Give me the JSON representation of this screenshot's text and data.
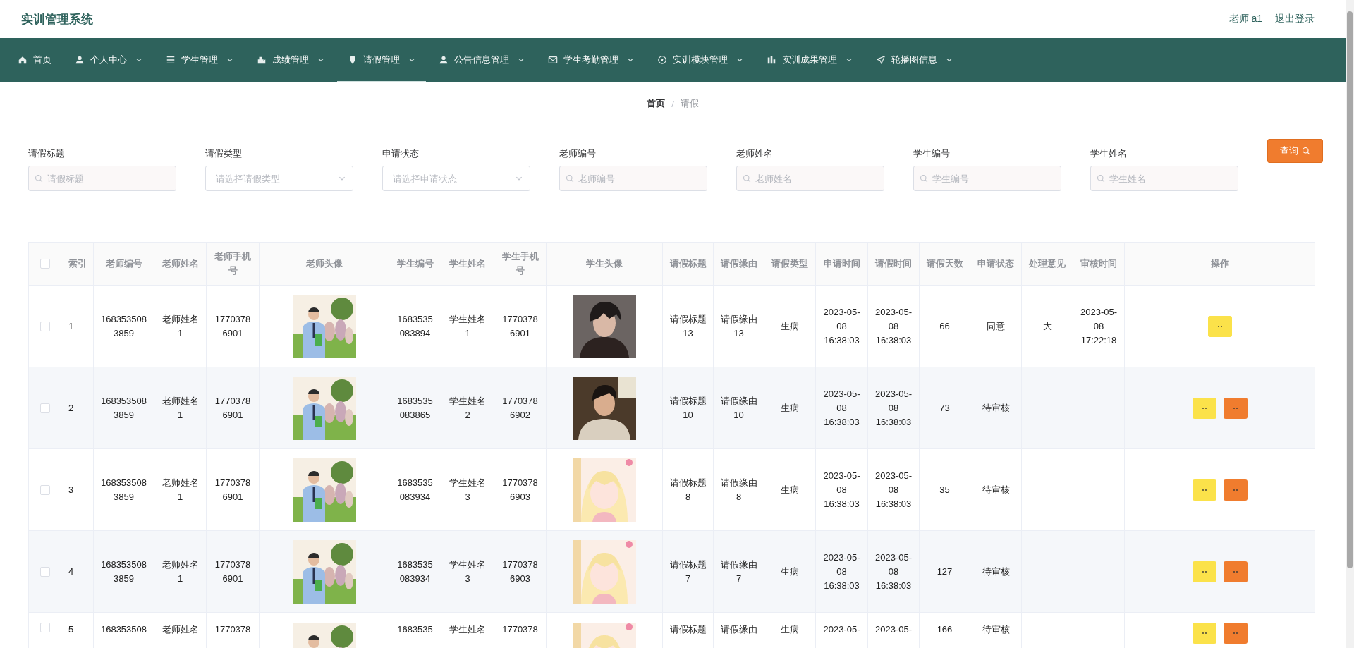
{
  "header": {
    "title": "实训管理系统",
    "user": "老师 a1",
    "logout": "退出登录"
  },
  "nav": [
    {
      "label": "首页",
      "has_menu": false,
      "selected": false
    },
    {
      "label": "个人中心",
      "has_menu": true,
      "selected": false
    },
    {
      "label": "学生管理",
      "has_menu": true,
      "selected": false
    },
    {
      "label": "成绩管理",
      "has_menu": true,
      "selected": false
    },
    {
      "label": "请假管理",
      "has_menu": true,
      "selected": true
    },
    {
      "label": "公告信息管理",
      "has_menu": true,
      "selected": false
    },
    {
      "label": "学生考勤管理",
      "has_menu": true,
      "selected": false
    },
    {
      "label": "实训模块管理",
      "has_menu": true,
      "selected": false
    },
    {
      "label": "实训成果管理",
      "has_menu": true,
      "selected": false
    },
    {
      "label": "轮播图信息",
      "has_menu": true,
      "selected": false
    }
  ],
  "breadcrumb": {
    "items": [
      "首页",
      "请假"
    ],
    "separator": "/"
  },
  "filters": [
    {
      "label": "请假标题",
      "placeholder": "请假标题",
      "kind": "text"
    },
    {
      "label": "请假类型",
      "placeholder": "请选择请假类型",
      "kind": "select"
    },
    {
      "label": "申请状态",
      "placeholder": "请选择申请状态",
      "kind": "select"
    },
    {
      "label": "老师编号",
      "placeholder": "老师编号",
      "kind": "text"
    },
    {
      "label": "老师姓名",
      "placeholder": "老师姓名",
      "kind": "text"
    },
    {
      "label": "学生编号",
      "placeholder": "学生编号",
      "kind": "text"
    },
    {
      "label": "学生姓名",
      "placeholder": "学生姓名",
      "kind": "text"
    }
  ],
  "search_button": "查询",
  "table": {
    "select_all": {
      "checked": false
    },
    "columns": [
      "索引",
      "老师编号",
      "老师姓名",
      "老师手机号",
      "老师头像",
      "学生编号",
      "学生姓名",
      "学生手机号",
      "学生头像",
      "请假标题",
      "请假缘由",
      "请假类型",
      "申请时间",
      "请假时间",
      "请假天数",
      "申请状态",
      "处理意见",
      "审核时间",
      "操作"
    ],
    "rows": [
      {
        "checked": false,
        "index": "1",
        "teacher_no": "1683535083859",
        "teacher_name": "老师姓名1",
        "teacher_phone": "17703786901",
        "student_no": "1683535083894",
        "student_name": "学生姓名1",
        "student_phone": "17703786901",
        "title": "请假标题13",
        "reason": "请假缘由13",
        "type": "生病",
        "apply_time": "2023-05-08 16:38:03",
        "leave_time": "2023-05-08 16:38:03",
        "days": "66",
        "status": "同意",
        "opinion": "大",
        "review_time": "2023-05-08 17:22:18",
        "actions": [
          {
            "kind": "warning"
          }
        ]
      },
      {
        "checked": false,
        "index": "2",
        "teacher_no": "1683535083859",
        "teacher_name": "老师姓名1",
        "teacher_phone": "17703786901",
        "student_no": "1683535083865",
        "student_name": "学生姓名2",
        "student_phone": "17703786902",
        "title": "请假标题10",
        "reason": "请假缘由10",
        "type": "生病",
        "apply_time": "2023-05-08 16:38:03",
        "leave_time": "2023-05-08 16:38:03",
        "days": "73",
        "status": "待审核",
        "actions": [
          {
            "kind": "warning"
          },
          {
            "kind": "danger"
          }
        ]
      },
      {
        "checked": false,
        "index": "3",
        "teacher_no": "1683535083859",
        "teacher_name": "老师姓名1",
        "teacher_phone": "17703786901",
        "student_no": "1683535083934",
        "student_name": "学生姓名3",
        "student_phone": "17703786903",
        "title": "请假标题8",
        "reason": "请假缘由8",
        "type": "生病",
        "apply_time": "2023-05-08 16:38:03",
        "leave_time": "2023-05-08 16:38:03",
        "days": "35",
        "status": "待审核",
        "actions": [
          {
            "kind": "warning"
          },
          {
            "kind": "danger"
          }
        ]
      },
      {
        "checked": false,
        "index": "4",
        "teacher_no": "1683535083859",
        "teacher_name": "老师姓名1",
        "teacher_phone": "17703786901",
        "student_no": "1683535083934",
        "student_name": "学生姓名3",
        "student_phone": "17703786903",
        "title": "请假标题7",
        "reason": "请假缘由7",
        "type": "生病",
        "apply_time": "2023-05-08 16:38:03",
        "leave_time": "2023-05-08 16:38:03",
        "days": "127",
        "status": "待审核",
        "actions": [
          {
            "kind": "warning"
          },
          {
            "kind": "danger"
          }
        ]
      },
      {
        "checked": false,
        "index": "5",
        "teacher_no": "168353508",
        "teacher_name": "老师姓名",
        "teacher_phone": "1770378",
        "student_no": "1683535",
        "student_name": "学生姓名",
        "student_phone": "1770378",
        "title": "请假标题",
        "reason": "请假缘由",
        "type": "生病",
        "apply_time": "2023-05-",
        "leave_time": "2023-05-",
        "days": "166",
        "status": "待审核",
        "actions": [
          {
            "kind": "warning"
          },
          {
            "kind": "danger"
          }
        ]
      }
    ]
  }
}
